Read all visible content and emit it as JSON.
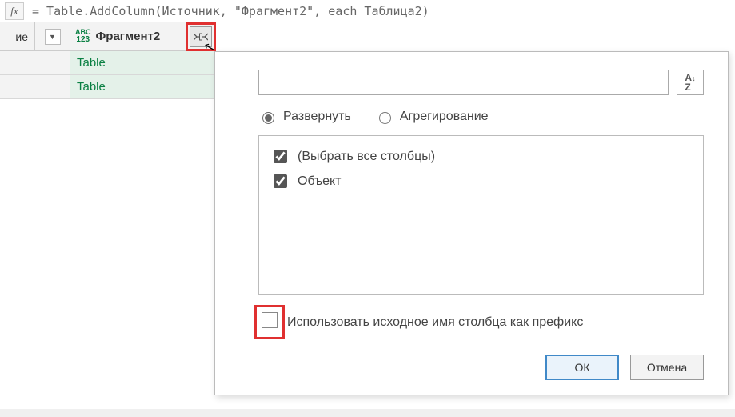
{
  "formula": {
    "fx_label": "fx",
    "text": "= Table.AddColumn(Источник, \"Фрагмент2\", each Таблица2)"
  },
  "grid": {
    "col1_suffix": "ие",
    "type_icon_top": "ABC",
    "type_icon_bottom": "123",
    "col2_name": "Фрагмент2",
    "rows": [
      {
        "value": "Table"
      },
      {
        "value": "Table"
      }
    ]
  },
  "popup": {
    "search_placeholder": "",
    "sort_label": "A↓\nZ↓",
    "radio_expand": "Развернуть",
    "radio_aggregate": "Агрегирование",
    "select_all": "(Выбрать все столбцы)",
    "columns": [
      {
        "label": "Объект",
        "checked": true
      }
    ],
    "prefix_label": "Использовать исходное имя столбца как префикс",
    "ok": "ОК",
    "cancel": "Отмена"
  }
}
